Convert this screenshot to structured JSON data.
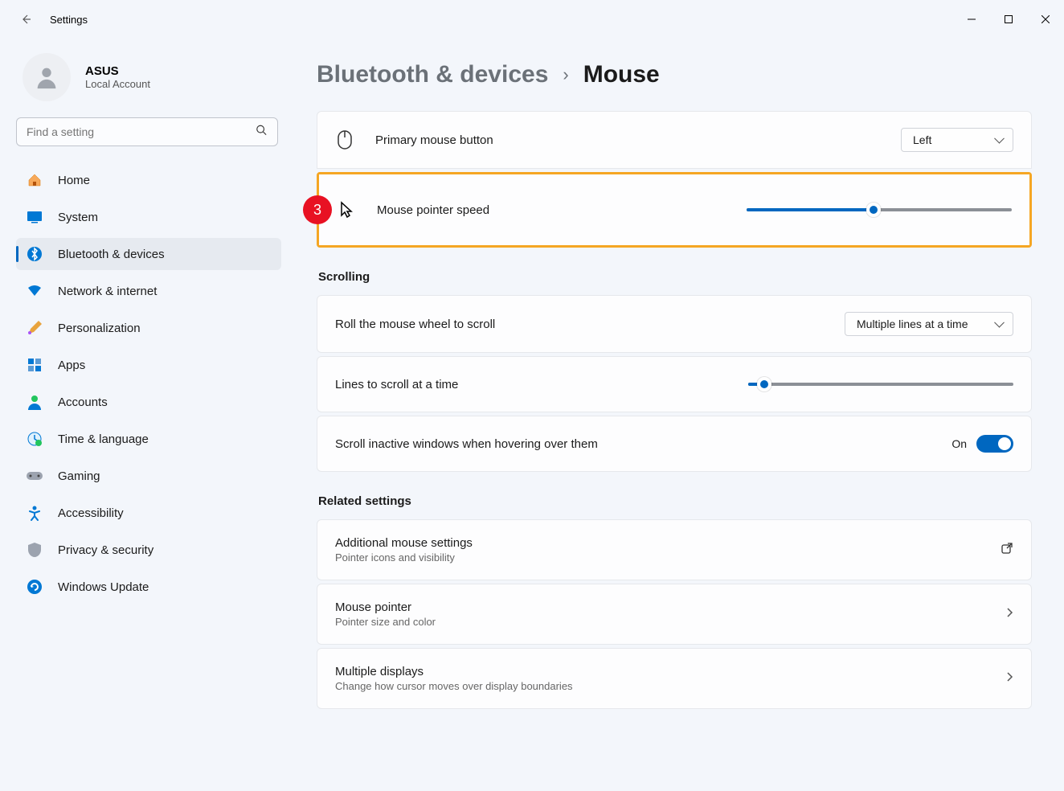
{
  "titlebar": {
    "app_title": "Settings"
  },
  "user": {
    "name": "ASUS",
    "role": "Local Account"
  },
  "search": {
    "placeholder": "Find a setting"
  },
  "nav": [
    {
      "label": "Home"
    },
    {
      "label": "System"
    },
    {
      "label": "Bluetooth & devices"
    },
    {
      "label": "Network & internet"
    },
    {
      "label": "Personalization"
    },
    {
      "label": "Apps"
    },
    {
      "label": "Accounts"
    },
    {
      "label": "Time & language"
    },
    {
      "label": "Gaming"
    },
    {
      "label": "Accessibility"
    },
    {
      "label": "Privacy & security"
    },
    {
      "label": "Windows Update"
    }
  ],
  "breadcrumb": {
    "parent": "Bluetooth & devices",
    "current": "Mouse"
  },
  "primary_button": {
    "label": "Primary mouse button",
    "value": "Left"
  },
  "pointer_speed": {
    "label": "Mouse pointer speed",
    "percent": 48
  },
  "annotation": {
    "badge": "3"
  },
  "section_scrolling": "Scrolling",
  "scroll_wheel": {
    "label": "Roll the mouse wheel to scroll",
    "value": "Multiple lines at a time"
  },
  "lines_scroll": {
    "label": "Lines to scroll at a time",
    "percent": 6
  },
  "inactive": {
    "label": "Scroll inactive windows when hovering over them",
    "state": "On"
  },
  "section_related": "Related settings",
  "related": [
    {
      "title": "Additional mouse settings",
      "sub": "Pointer icons and visibility"
    },
    {
      "title": "Mouse pointer",
      "sub": "Pointer size and color"
    },
    {
      "title": "Multiple displays",
      "sub": "Change how cursor moves over display boundaries"
    }
  ]
}
